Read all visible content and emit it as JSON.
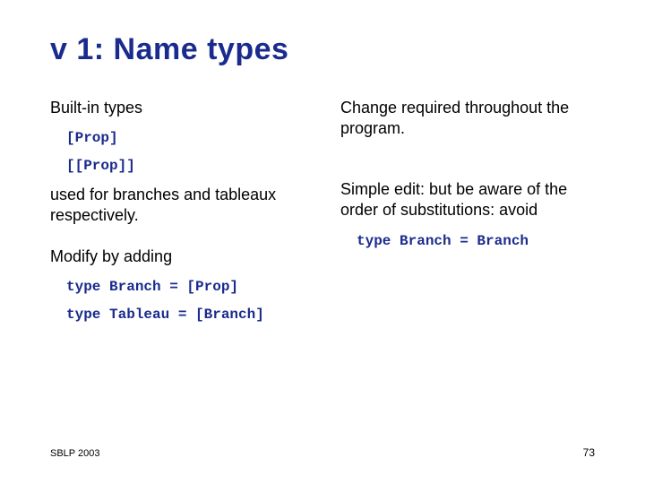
{
  "title": "v 1: Name types",
  "left": {
    "p1": "Built-in types",
    "c1": "[Prop]",
    "c2": "[[Prop]]",
    "p2": "used for branches and tableaux respectively.",
    "p3": "Modify by adding",
    "c3": "type Branch = [Prop]",
    "c4": "type Tableau = [Branch]"
  },
  "right": {
    "p1": "Change required throughout the program.",
    "p2": "Simple edit: but be aware of the order of substitutions: avoid",
    "c1": "type Branch = Branch"
  },
  "footer": {
    "left": "SBLP 2003",
    "right": "73"
  }
}
